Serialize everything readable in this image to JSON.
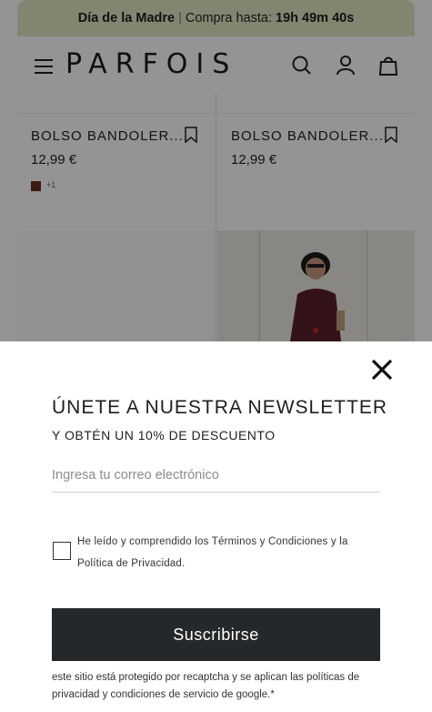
{
  "promo": {
    "event": "Día de la Madre",
    "separator": "|",
    "text": "Compra hasta:",
    "countdown": "19h 49m 40s"
  },
  "header": {
    "logo": "PARFOIS",
    "icons": [
      "menu-icon",
      "search-icon",
      "user-icon",
      "bag-icon"
    ]
  },
  "products": [
    {
      "name": "BOLSO BANDOLER...",
      "price": "12,99 €",
      "swatch_color": "#6a2d1a",
      "more_colors": "+1"
    },
    {
      "name": "BOLSO BANDOLER...",
      "price": "12,99 €"
    }
  ],
  "newsletter": {
    "title": "ÚNETE A NUESTRA NEWSLETTER",
    "subtitle": "Y OBTÉN UN 10% DE DESCUENTO",
    "email_placeholder": "Ingresa tu correo electrónico",
    "email_value": "",
    "consent": "He leído y comprendido los Términos y Condiciones y la Política de Privacidad.",
    "submit_label": "Suscribirse",
    "recaptcha": "este sitio está protegido por recaptcha y se aplican las políticas de privacidad y condiciones de servicio de google.*"
  },
  "colors": {
    "promo_bg": "#e4e6c3",
    "button_bg": "#25282a",
    "overlay": "rgba(0,0,0,0.42)"
  }
}
